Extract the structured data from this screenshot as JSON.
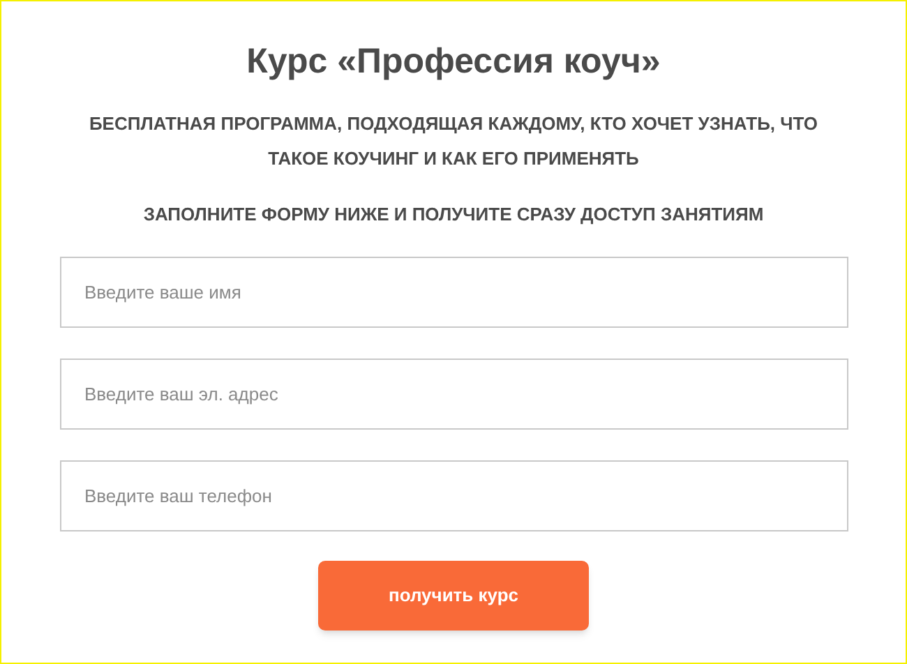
{
  "title": "Курс «Профессия коуч»",
  "subtitle": "БЕСПЛАТНАЯ ПРОГРАММА, ПОДХОДЯЩАЯ КАЖДОМУ, КТО ХОЧЕТ УЗНАТЬ, ЧТО ТАКОЕ КОУЧИНГ И КАК ЕГО ПРИМЕНЯТЬ",
  "instruction": "ЗАПОЛНИТЕ ФОРМУ НИЖЕ И ПОЛУЧИТЕ СРАЗУ ДОСТУП ЗАНЯТИЯМ",
  "fields": [
    {
      "placeholder": "Введите ваше имя"
    },
    {
      "placeholder": "Введите ваш эл. адрес"
    },
    {
      "placeholder": "Введите ваш телефон"
    }
  ],
  "submit_button": "получить курс"
}
